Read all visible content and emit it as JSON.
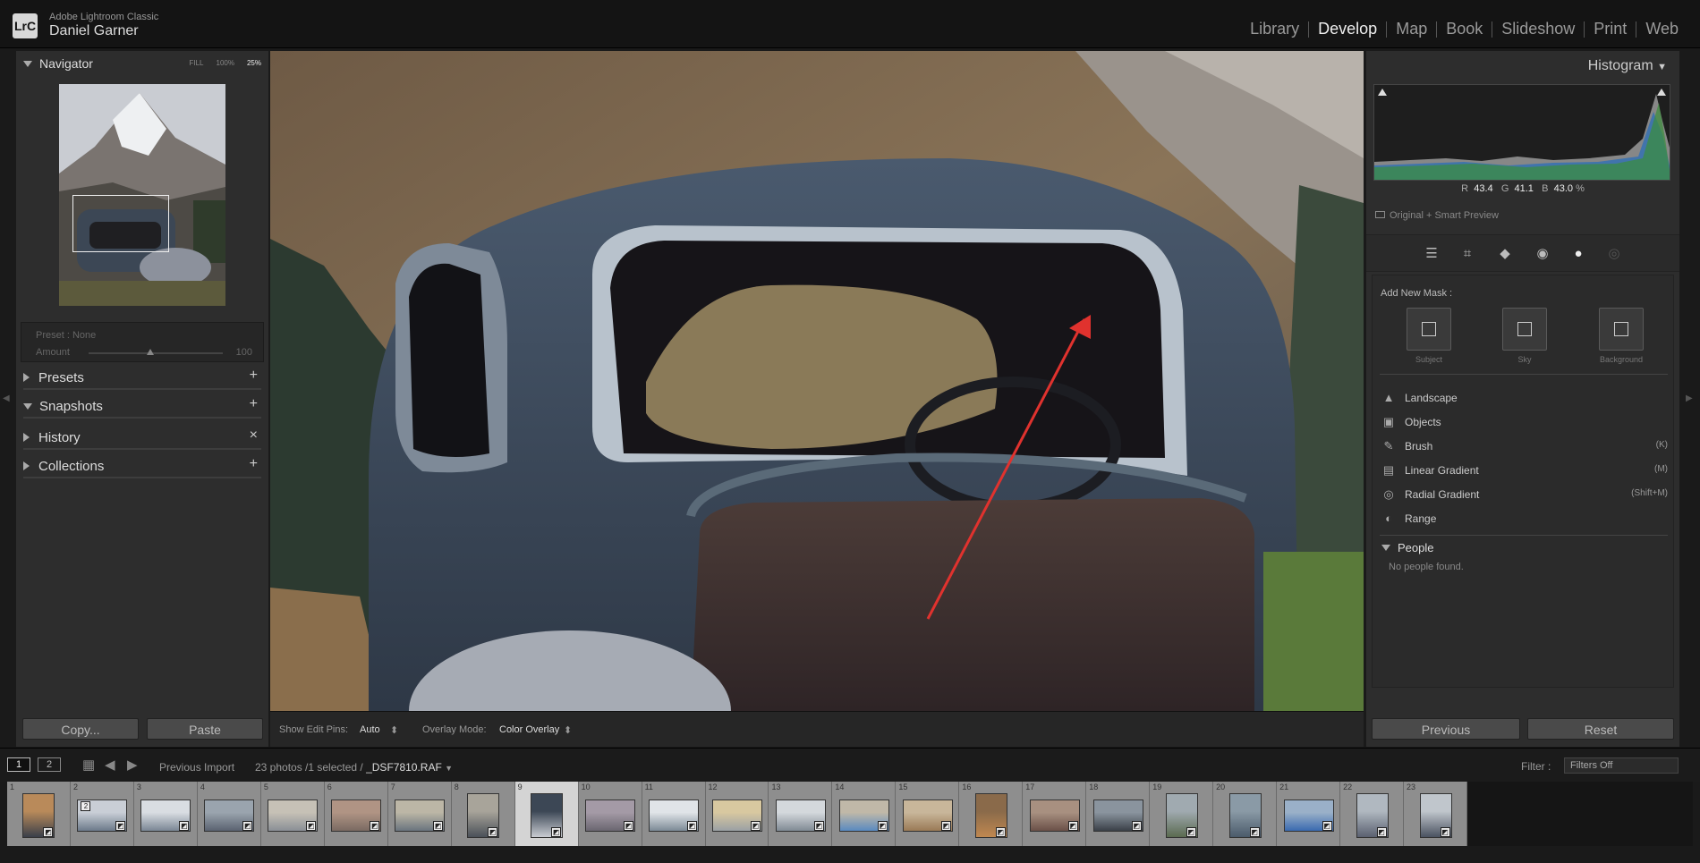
{
  "app": {
    "name": "Adobe Lightroom Classic",
    "user": "Daniel Garner",
    "logo": "LrC"
  },
  "modules": [
    "Library",
    "Develop",
    "Map",
    "Book",
    "Slideshow",
    "Print",
    "Web"
  ],
  "active_module": "Develop",
  "navigator": {
    "title": "Navigator",
    "zoom_fill": "FILL",
    "zoom_100": "100%",
    "zoom_25": "25%"
  },
  "preset_amount": {
    "preset_label": "Preset :",
    "preset_value": "None",
    "amount_label": "Amount",
    "amount_value": "100"
  },
  "left_sections": [
    {
      "label": "Presets",
      "action": "+"
    },
    {
      "label": "Snapshots",
      "action": "+"
    },
    {
      "label": "History",
      "action": "×"
    },
    {
      "label": "Collections",
      "action": "+"
    }
  ],
  "left_buttons": {
    "copy": "Copy...",
    "paste": "Paste"
  },
  "toolbar": {
    "pins_label": "Show Edit Pins:",
    "pins_value": "Auto",
    "overlay_label": "Overlay Mode:",
    "overlay_value": "Color Overlay"
  },
  "histogram": {
    "title": "Histogram",
    "r_label": "R",
    "r_value": "43.4",
    "g_label": "G",
    "g_value": "41.1",
    "b_label": "B",
    "b_value": "43.0",
    "unit": "%",
    "preview": "Original + Smart Preview"
  },
  "masking": {
    "add_new": "Add New Mask :",
    "presets": [
      {
        "label": "Subject",
        "icon": "subject-icon"
      },
      {
        "label": "Sky",
        "icon": "sky-icon"
      },
      {
        "label": "Background",
        "icon": "background-icon"
      }
    ],
    "tools": [
      {
        "label": "Landscape",
        "shortcut": "",
        "icon": "landscape-icon"
      },
      {
        "label": "Objects",
        "shortcut": "",
        "icon": "objects-icon"
      },
      {
        "label": "Brush",
        "shortcut": "(K)",
        "icon": "brush-icon"
      },
      {
        "label": "Linear Gradient",
        "shortcut": "(M)",
        "icon": "linear-gradient-icon"
      },
      {
        "label": "Radial Gradient",
        "shortcut": "(Shift+M)",
        "icon": "radial-gradient-icon"
      },
      {
        "label": "Range",
        "shortcut": "",
        "icon": "range-icon"
      }
    ],
    "people_title": "People",
    "people_empty": "No people found."
  },
  "right_buttons": {
    "previous": "Previous",
    "reset": "Reset"
  },
  "filmstrip": {
    "screen1": "1",
    "screen2": "2",
    "source": "Previous Import",
    "count": "23 photos /1 selected /",
    "filename": "_DSF7810.RAF",
    "filter_label": "Filter :",
    "filter_value": "Filters Off",
    "numbers": [
      "1",
      "2",
      "3",
      "4",
      "5",
      "6",
      "7",
      "8",
      "9",
      "10",
      "11",
      "12",
      "13",
      "14",
      "15",
      "16",
      "17",
      "18",
      "19",
      "20",
      "21",
      "22",
      "23"
    ],
    "selected_index": 8,
    "stack_badge": "2"
  },
  "colors": {
    "accent_arrow": "#e0322e",
    "panel": "#2d2d2d",
    "background": "#1a1a1a"
  }
}
